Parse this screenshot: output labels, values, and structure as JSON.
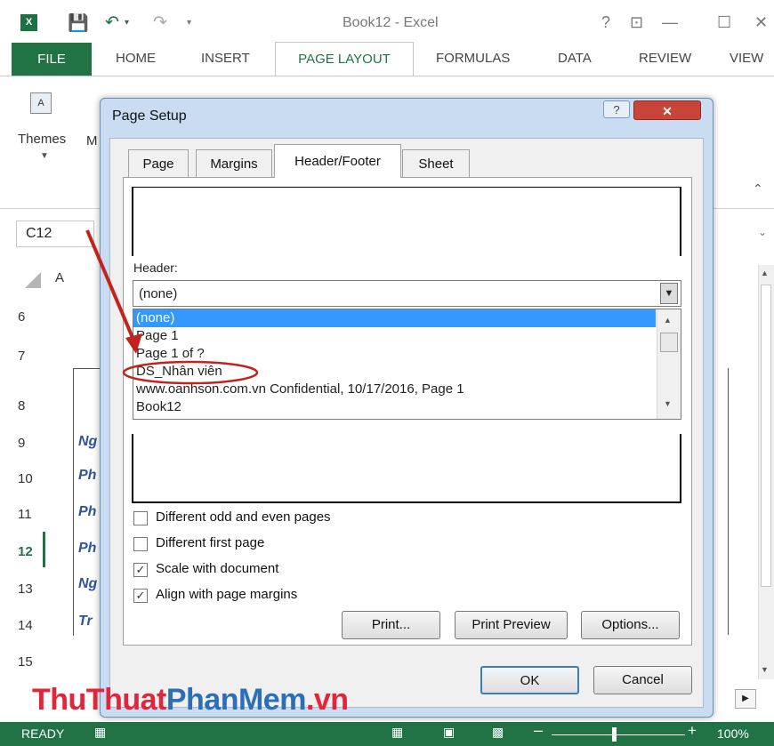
{
  "excel": {
    "logo_text": "X",
    "book_title": "Book12 - Excel",
    "window_controls": [
      "?",
      "⊡",
      "—",
      "☐",
      "✕"
    ],
    "tabs": [
      "FILE",
      "HOME",
      "INSERT",
      "PAGE LAYOUT",
      "FORMULAS",
      "DATA",
      "REVIEW",
      "VIEW"
    ],
    "active_tab": "PAGE LAYOUT",
    "themes_label": "Themes",
    "m_label": "M",
    "name_box": "C12",
    "column_a": "A",
    "rows": [
      "6",
      "7",
      "8",
      "9",
      "10",
      "11",
      "12",
      "13",
      "14",
      "15"
    ],
    "active_row": "12",
    "cell_fragments": [
      "Ng",
      "Ph",
      "Ph",
      "Ph",
      "Ng",
      "Tr"
    ],
    "status_ready": "READY",
    "zoom": "100%",
    "accent": "#217346"
  },
  "dialog": {
    "title": "Page Setup",
    "help": "?",
    "close": "✕",
    "tabs": [
      "Page",
      "Margins",
      "Header/Footer",
      "Sheet"
    ],
    "active_tab": "Header/Footer",
    "header_label": "Header:",
    "header_value": "(none)",
    "header_options": [
      "(none)",
      "Page 1",
      "Page 1 of ?",
      "DS_Nhân viên",
      "www.oanhson.com.vn Confidential, 10/17/2016, Page 1",
      "Book12"
    ],
    "selected_option": "(none)",
    "checkboxes": [
      {
        "label": "Different odd and even pages",
        "checked": false
      },
      {
        "label": "Different first page",
        "checked": false
      },
      {
        "label": "Scale with document",
        "checked": true
      },
      {
        "label": "Align with page margins",
        "checked": true
      }
    ],
    "buttons": {
      "print": "Print...",
      "print_preview": "Print Preview",
      "options": "Options...",
      "ok": "OK",
      "cancel": "Cancel"
    }
  },
  "watermark": {
    "part1": "ThuThuat",
    "part2": "PhanMem",
    "part3": ".vn"
  }
}
